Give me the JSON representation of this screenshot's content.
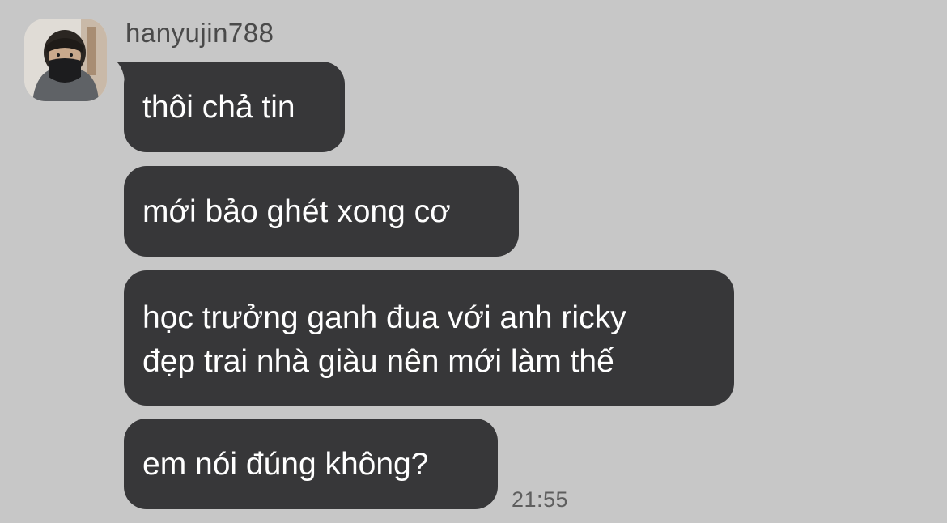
{
  "chat": {
    "sender": {
      "username": "hanyujin788",
      "avatar": "user-avatar-photo"
    },
    "messages": [
      {
        "lines": [
          "thôi chả tin"
        ]
      },
      {
        "lines": [
          "mới bảo ghét xong cơ"
        ]
      },
      {
        "lines": [
          "học trưởng ganh đua với anh ricky",
          "đẹp trai nhà giàu nên mới làm thế"
        ]
      },
      {
        "lines": [
          "em nói đúng không?"
        ]
      }
    ],
    "timestamp": "21:55"
  },
  "colors": {
    "background": "#c7c7c7",
    "bubble": "#373739",
    "bubble_text": "#ffffff",
    "username": "#4a4a4a",
    "timestamp": "#5e5e5e"
  }
}
